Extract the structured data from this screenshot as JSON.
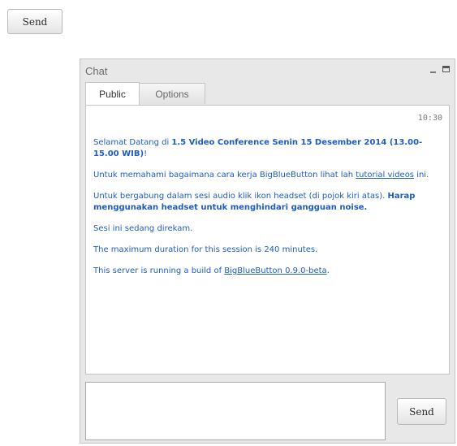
{
  "top_send": {
    "label": "Send"
  },
  "chat": {
    "title": "Chat",
    "tabs": [
      {
        "label": "Public",
        "active": true
      },
      {
        "label": "Options",
        "active": false
      }
    ],
    "timestamp": "10:30",
    "messages": {
      "welcome_prefix": "Selamat Datang di ",
      "welcome_bold": "1.5 Video Conference Senin 15 Desember 2014 (13.00-15.00 WIB)",
      "welcome_suffix": "!",
      "howto_text": "Untuk memahami bagaimana cara kerja BigBlueButton lihat lah ",
      "howto_link": "tutorial videos",
      "howto_suffix": " ini.",
      "audio_prefix": "Untuk bergabung dalam sesi audio klik ikon headset (di pojok kiri atas). ",
      "audio_bold": "Harap menggunakan headset untuk menghindari gangguan noise.",
      "recording": "Sesi ini sedang direkam.",
      "duration": "The maximum duration for this session is 240 minutes.",
      "build_prefix": "This server is running a build of ",
      "build_link": "BigBlueButton 0.9.0-beta",
      "build_suffix": "."
    },
    "input": {
      "value": "",
      "placeholder": ""
    },
    "send_label": "Send"
  },
  "icons": {
    "minimize": "minimize-icon",
    "maximize": "maximize-icon"
  },
  "colors": {
    "message_text": "#1d5cc4",
    "window_bg": "#e8e8e8",
    "title_text": "#6b6b6b"
  }
}
